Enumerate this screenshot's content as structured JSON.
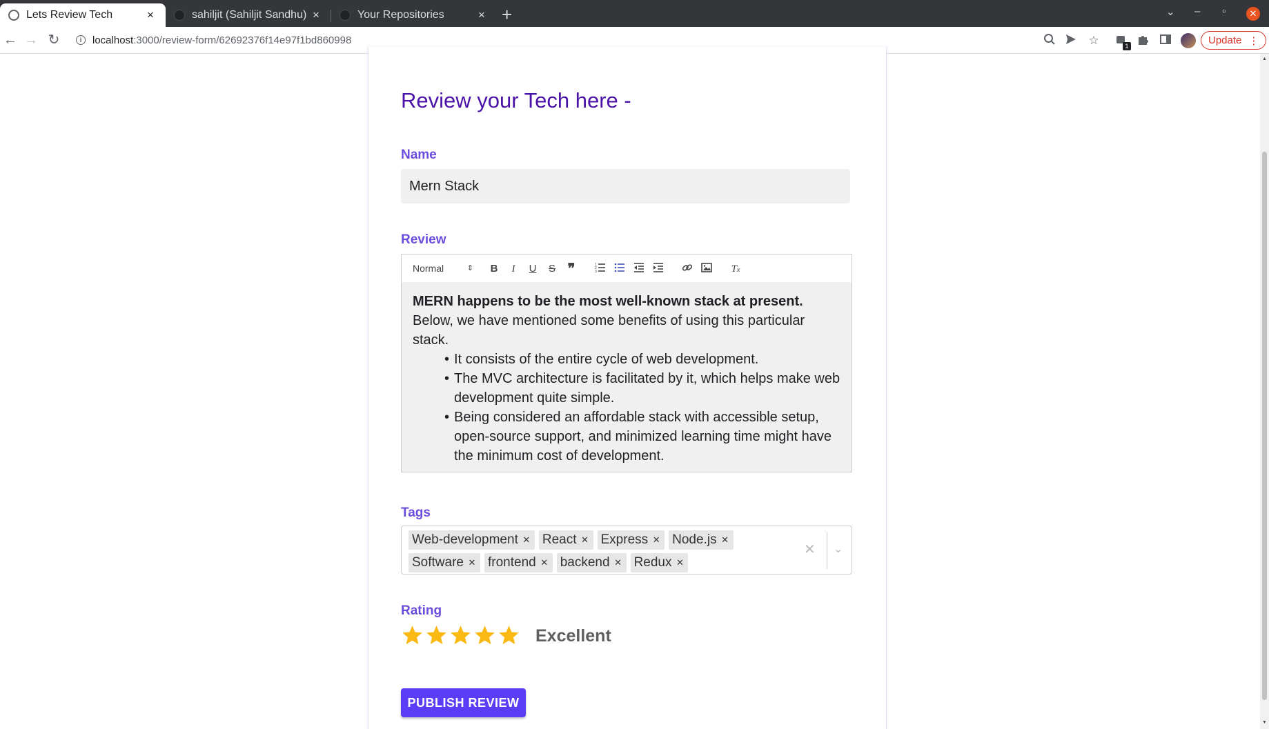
{
  "browser": {
    "tabs": [
      {
        "title": "Lets Review Tech",
        "active": true
      },
      {
        "title": "sahiljit (Sahiljit Sandhu)",
        "active": false
      },
      {
        "title": "Your Repositories",
        "active": false
      }
    ],
    "new_tab": "+",
    "tab_close": "×",
    "url_host": "localhost",
    "url_path": ":3000/review-form/62692376f14e97f1bd860998",
    "extension_badge": "1",
    "update_label": "Update",
    "window_controls": {
      "list": "⌄",
      "minimize": "–",
      "maximize": "▫",
      "close": "✕"
    }
  },
  "form": {
    "title": "Review your Tech here -",
    "name_label": "Name",
    "name_value": "Mern Stack",
    "review_label": "Review",
    "editor": {
      "heading_select": "Normal",
      "toolbar_buttons": [
        "bold",
        "italic",
        "underline",
        "strike",
        "blockquote",
        "ordered-list",
        "bullet-list",
        "indent-decrease",
        "indent-increase",
        "link",
        "image",
        "clean"
      ],
      "active_button": "bullet-list",
      "intro_bold": " MERN happens to be the most well-known stack at present.",
      "intro_rest": " Below, we have mentioned some benefits of using this particular stack.",
      "bullets": [
        "It consists of the entire cycle of web development.",
        "The MVC architecture is facilitated by it, which helps make web development quite simple.",
        "Being considered an affordable stack with accessible setup, open-source support, and minimized learning time might have the minimum cost of development."
      ]
    },
    "tags_label": "Tags",
    "tags": [
      "Web-development",
      "React",
      "Express",
      "Node.js",
      "Software",
      "frontend",
      "backend",
      "Redux"
    ],
    "rating_label": "Rating",
    "rating_value": 5,
    "rating_max": 5,
    "rating_text": "Excellent",
    "publish_label": "PUBLISH REVIEW"
  },
  "colors": {
    "title": "#4a12a8",
    "label": "#6a4ddc",
    "star": "#fbb913",
    "button": "#5b3df5",
    "editor_active": "#3f51b5"
  }
}
